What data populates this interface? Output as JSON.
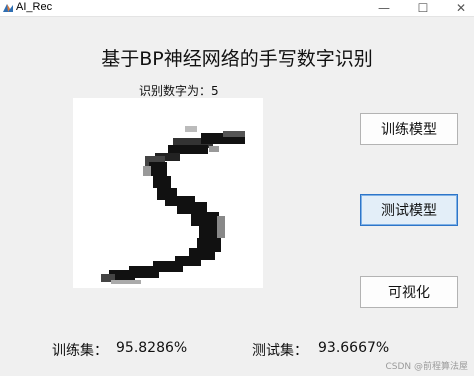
{
  "window": {
    "title": "AI_Rec",
    "min_glyph": "—",
    "max_glyph": "☐",
    "close_glyph": "✕"
  },
  "main": {
    "title": "基于BP神经网络的手写数字识别",
    "recognition_label": "识别数字为：5"
  },
  "digit_image": {
    "depicts": "handwritten-digit-5"
  },
  "buttons": {
    "train": "训练模型",
    "test": "测试模型",
    "visualize": "可视化"
  },
  "stats": {
    "train_label": "训练集：",
    "train_value": "95.8286%",
    "test_label": "测试集：",
    "test_value": "93.6667%"
  },
  "watermark": "CSDN @前程算法屋",
  "colors": {
    "background": "#f0f0f0",
    "test_button_focus": "#2e75c8",
    "app_icon": "#2f6fb3"
  }
}
